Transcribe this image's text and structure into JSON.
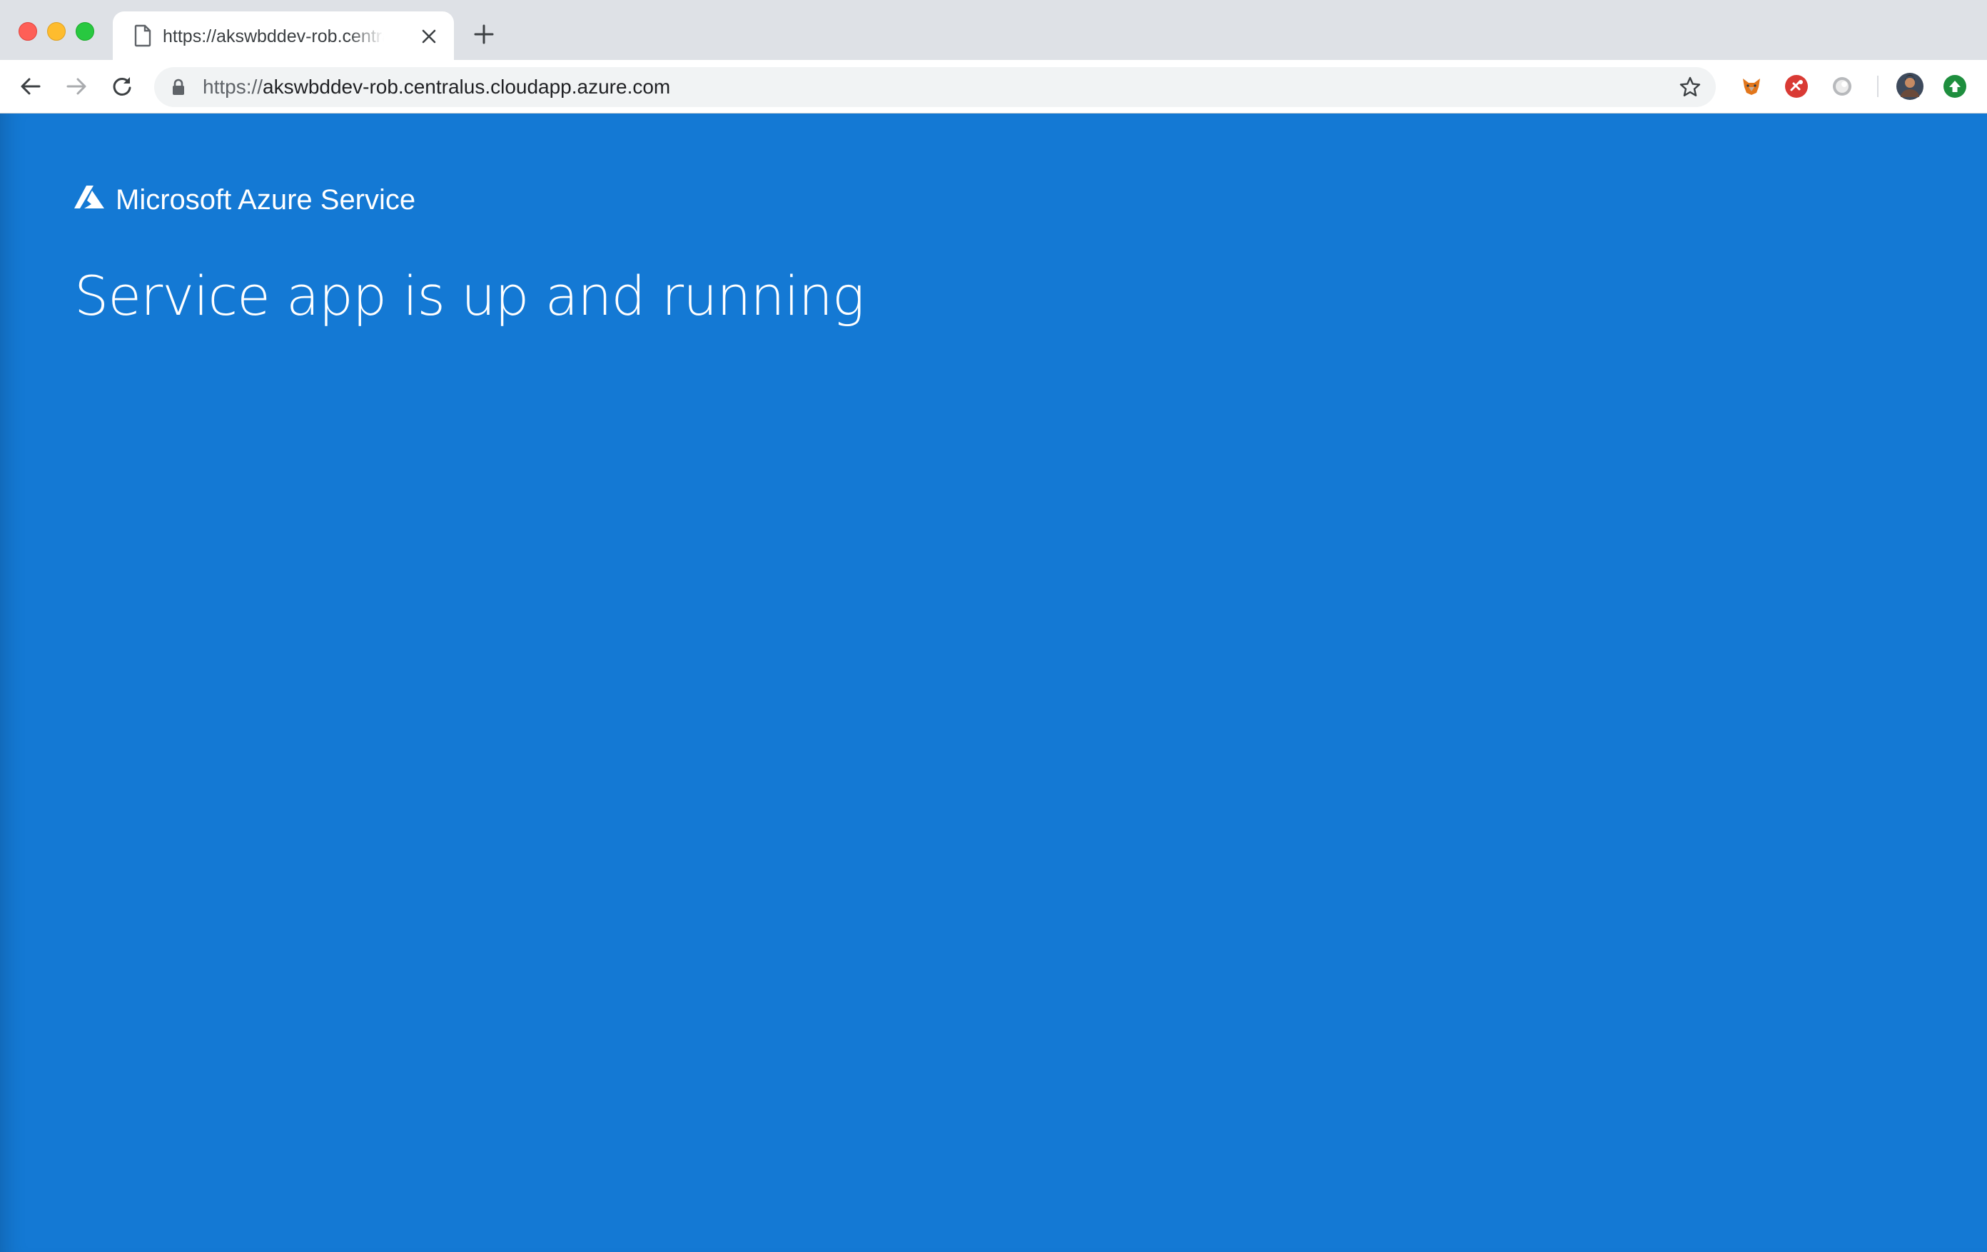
{
  "window": {
    "tab": {
      "title": "https://akswbddev-rob.centralus.cloudapp.azure.com",
      "favicon": "document-icon"
    }
  },
  "toolbar": {
    "url": {
      "scheme": "https://",
      "host": "akswbddev-rob.centralus.cloudapp.azure.com"
    },
    "extensions": [
      "fox-extension-icon",
      "red-extension-icon",
      "grey-circle-extension-icon",
      "profile-avatar",
      "green-upload-extension-icon"
    ]
  },
  "page": {
    "brand": "Microsoft Azure Service",
    "headline": "Service app is up and running"
  },
  "colors": {
    "page_background": "#1479d4",
    "text": "#ffffff"
  }
}
